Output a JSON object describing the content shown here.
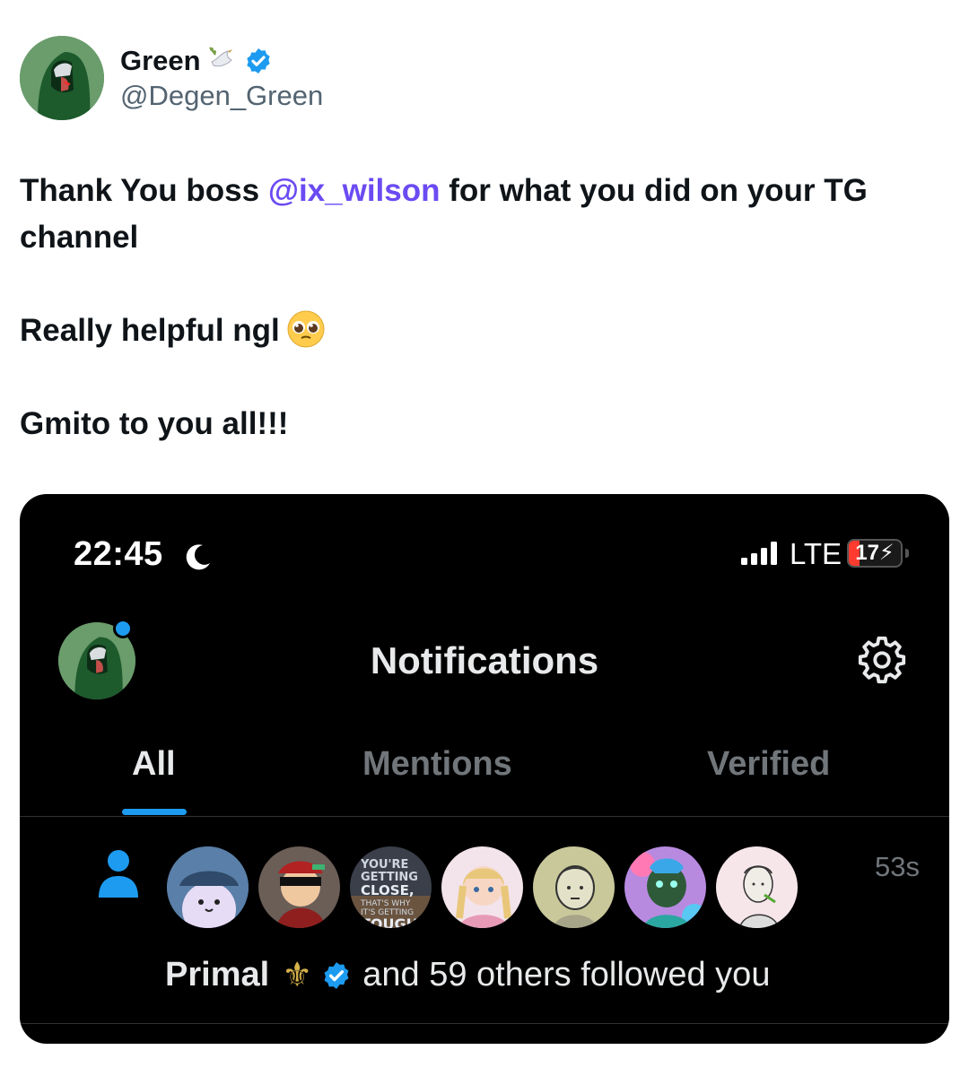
{
  "tweet": {
    "display_name": "Green",
    "handle": "@Degen_Green",
    "text": {
      "line1_before": "Thank You boss ",
      "mention": "@ix_wilson",
      "line1_after": " for what you did on your TG channel",
      "line2": "Really helpful ngl",
      "line3": "Gmito to you all!!!"
    },
    "icons": [
      "dove-emoji",
      "verified-badge-icon",
      "pleading-face-emoji"
    ]
  },
  "phone": {
    "status_bar": {
      "time": "22:45",
      "network": "LTE",
      "battery": "17"
    },
    "nav": {
      "title": "Notifications"
    },
    "tabs": [
      {
        "label": "All",
        "active": true
      },
      {
        "label": "Mentions",
        "active": false
      },
      {
        "label": "Verified",
        "active": false
      }
    ],
    "notification": {
      "time_ago": "53s",
      "name": "Primal",
      "name_emoji": "⚜",
      "text": "and 59 others followed you",
      "follower_avatar_count": 7
    }
  },
  "colors": {
    "mention": "#6b4bf2",
    "verified": "#1d9bf0",
    "tab_active": "#e7e9ea",
    "tab_inactive": "#71767b",
    "battery_low": "#ff3b30"
  }
}
